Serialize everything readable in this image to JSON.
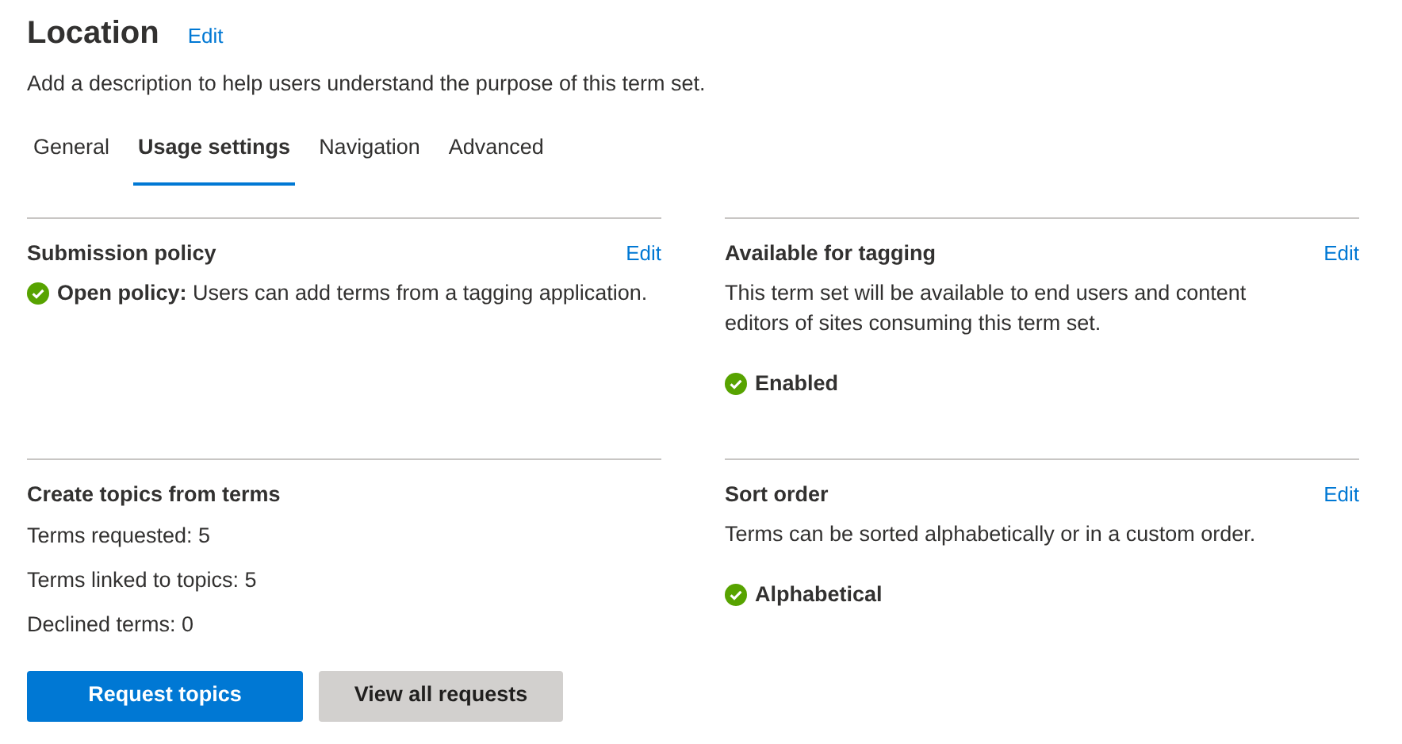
{
  "header": {
    "title": "Location",
    "edit": "Edit",
    "description": "Add a description to help users understand the purpose of this term set."
  },
  "tabs": [
    {
      "label": "General",
      "selected": false
    },
    {
      "label": "Usage settings",
      "selected": true
    },
    {
      "label": "Navigation",
      "selected": false
    },
    {
      "label": "Advanced",
      "selected": false
    }
  ],
  "sections": [
    {
      "title": "Submission policy",
      "edit": "Edit",
      "status": {
        "kind": "note",
        "text": "**Open policy:** Users can add terms from a tagging application."
      }
    },
    {
      "title": "Available for tagging",
      "edit": "Edit",
      "description": "This term set will be available to end users and content editors of sites consuming this term set.",
      "status": {
        "kind": "badge",
        "text": "Enabled"
      }
    },
    {
      "title": "Create topics from terms",
      "lines": [
        "Terms requested: 5",
        "Terms linked to topics: 5",
        "Declined terms: 0"
      ],
      "buttons": [
        {
          "label": "Request topics",
          "kind": "primary"
        },
        {
          "label": "View all requests",
          "kind": "secondary"
        }
      ]
    },
    {
      "title": "Sort order",
      "edit": "Edit",
      "description": "Terms can be sorted alphabetically or in a custom order.",
      "status": {
        "kind": "badge",
        "text": "Alphabetical"
      }
    }
  ]
}
